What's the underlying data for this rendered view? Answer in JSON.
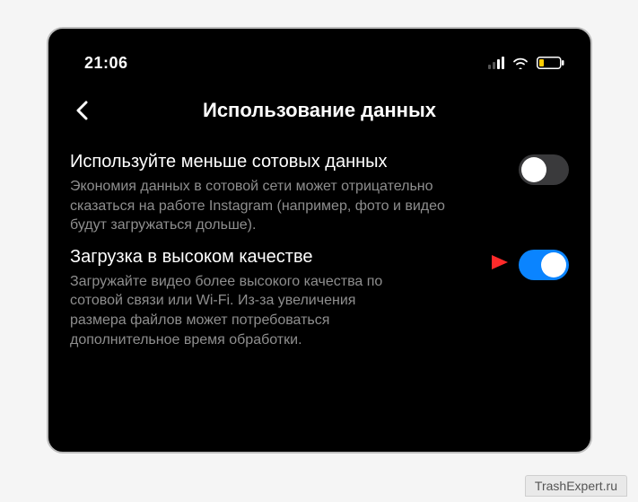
{
  "status": {
    "time": "21:06"
  },
  "header": {
    "title": "Использование данных"
  },
  "settings": [
    {
      "key": "use_less_cellular",
      "title": "Используйте меньше сотовых данных",
      "description": "Экономия данных в сотовой сети может отрицательно сказаться на работе Instagram (например, фото и видео будут загружаться дольше).",
      "enabled": false,
      "highlighted": false
    },
    {
      "key": "high_quality_upload",
      "title": "Загрузка в высоком качестве",
      "description": "Загружайте видео более высокого качества по сотовой связи или Wi-Fi. Из-за увеличения размера файлов может потребоваться дополнительное время обработки.",
      "enabled": true,
      "highlighted": true
    }
  ],
  "watermark": "TrashExpert.ru"
}
